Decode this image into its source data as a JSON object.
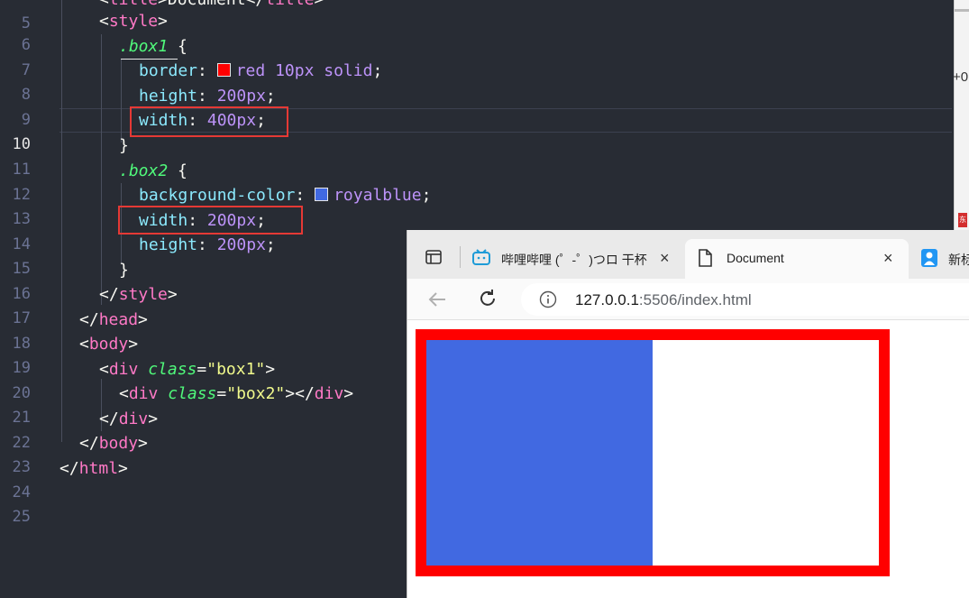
{
  "editor": {
    "lines": [
      {
        "n": "5"
      },
      {
        "n": "6"
      },
      {
        "n": "7"
      },
      {
        "n": "8"
      },
      {
        "n": "9"
      },
      {
        "n": "10"
      },
      {
        "n": "11"
      },
      {
        "n": "12"
      },
      {
        "n": "13"
      },
      {
        "n": "14"
      },
      {
        "n": "15"
      },
      {
        "n": "16"
      },
      {
        "n": "17"
      },
      {
        "n": "18"
      },
      {
        "n": "19"
      },
      {
        "n": "20"
      },
      {
        "n": "21"
      },
      {
        "n": "22"
      },
      {
        "n": "23"
      },
      {
        "n": "24"
      },
      {
        "n": "25"
      }
    ],
    "code": {
      "l5_open": "<",
      "l5_tag": "title",
      "l5_text": ">Document</",
      "l5_tag2": "title",
      "l5_close": ">",
      "l6_tag": "style",
      "l7_sel": ".box1",
      "l7_brace": "{",
      "l8_prop": "border",
      "l8_color": "red",
      "l8_rest": "10px solid",
      "l9_prop": "height",
      "l9_val": "200px",
      "l10_prop": "width",
      "l10_val": "400px",
      "l11_brace": "}",
      "l12_sel": ".box2",
      "l12_brace": "{",
      "l13_prop": "background-color",
      "l13_val": "royalblue",
      "l14_prop": "width",
      "l14_val": "200px",
      "l15_prop": "height",
      "l15_val": "200px",
      "l16_brace": "}",
      "l17_tag": "style",
      "l18_tag": "head",
      "l19_tag": "body",
      "l20_tag": "div",
      "l20_attr": "class",
      "l20_str": "\"box1\"",
      "l21_tag": "div",
      "l21_attr": "class",
      "l21_str": "\"box2\"",
      "l21_tag2": "div",
      "l22_tag": "div",
      "l23_tag": "body",
      "l24_tag": "html"
    },
    "colors": {
      "red_swatch": "#ff0000",
      "royalblue_swatch": "#4169e1"
    }
  },
  "right_strip": {
    "text": "+0",
    "badge": "东"
  },
  "browser": {
    "tabs": [
      {
        "label": "哔哩哔哩 (゜-゜)つロ 干杯",
        "close": "×",
        "icon": "bilibili-icon"
      },
      {
        "label": "Document",
        "close": "×",
        "icon": "document-icon"
      },
      {
        "label": "新标",
        "icon": "person-icon"
      }
    ],
    "url_host": "127.0.0.1",
    "url_rest": ":5506/index.html",
    "page": {
      "box1": {
        "border_color": "#ff0000"
      },
      "box2": {
        "background": "#4169e1"
      }
    }
  }
}
